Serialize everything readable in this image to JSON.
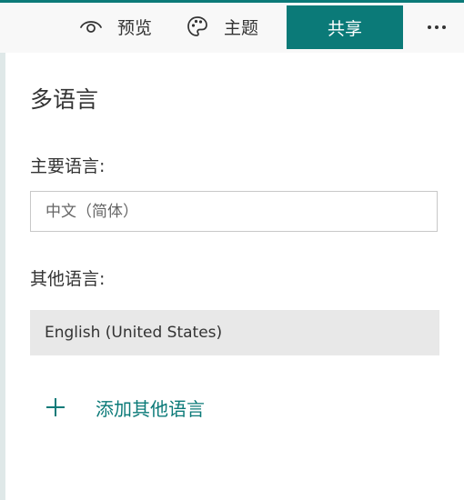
{
  "toolbar": {
    "preview_label": "预览",
    "theme_label": "主题",
    "share_label": "共享",
    "more_icon": "more-horizontal-icon",
    "preview_icon": "eye-icon",
    "theme_icon": "palette-icon"
  },
  "panel": {
    "title": "多语言",
    "primary_label": "主要语言:",
    "primary_placeholder": "中文（简体）",
    "other_label": "其他语言:",
    "other_languages": [
      "English (United States)"
    ],
    "add_label": "添加其他语言",
    "add_icon": "plus-icon"
  },
  "colors": {
    "accent": "#0b7a78",
    "selected_bg": "#e8e8e8",
    "text": "#333333"
  }
}
